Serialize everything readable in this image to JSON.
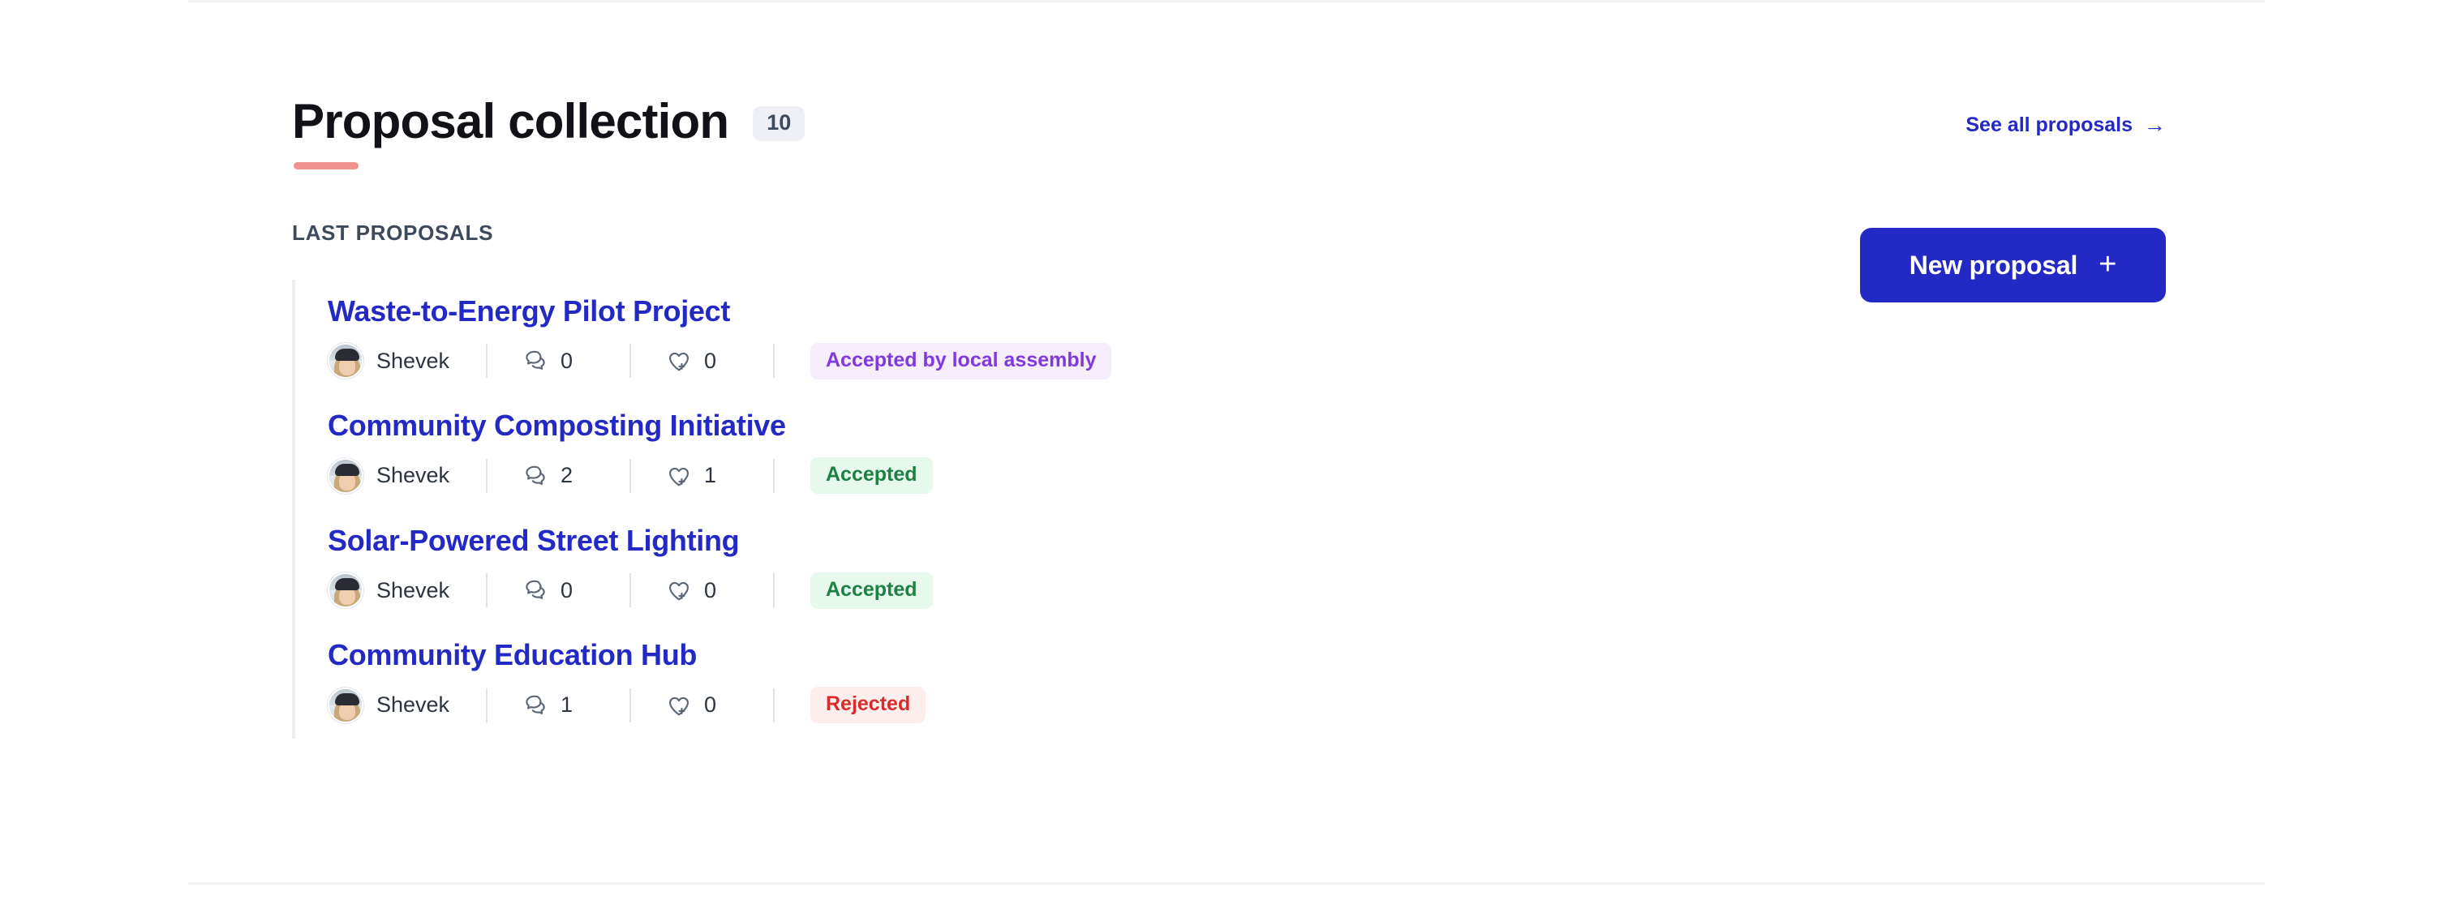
{
  "header": {
    "title": "Proposal collection",
    "count": "10",
    "see_all_label": "See all proposals",
    "see_all_arrow_icon": "arrow-right-icon",
    "underline_color": "#f0928e",
    "title_color": "#111118",
    "link_color": "#2329c4"
  },
  "subheader": {
    "section_label": "LAST PROPOSALS",
    "new_proposal_label": "New proposal",
    "new_proposal_plus_icon": "plus-icon",
    "button_color": "#2329c4"
  },
  "icons": {
    "comments": "comments-icon",
    "endorsements": "heart-plus-icon",
    "avatar": "user-avatar"
  },
  "proposals": [
    {
      "title": "Waste-to-Energy Pilot Project",
      "author": "Shevek",
      "comments": "0",
      "endorsements": "0",
      "status": "Accepted by local assembly",
      "status_style": "status-purple",
      "status_bg": "#f6edfd",
      "status_fg": "#8039dd"
    },
    {
      "title": "Community Composting Initiative",
      "author": "Shevek",
      "comments": "2",
      "endorsements": "1",
      "status": "Accepted",
      "status_style": "status-green",
      "status_bg": "#e7f8ec",
      "status_fg": "#1e8043"
    },
    {
      "title": "Solar-Powered Street Lighting",
      "author": "Shevek",
      "comments": "0",
      "endorsements": "0",
      "status": "Accepted",
      "status_style": "status-green",
      "status_bg": "#e7f8ec",
      "status_fg": "#1e8043"
    },
    {
      "title": "Community Education Hub",
      "author": "Shevek",
      "comments": "1",
      "endorsements": "0",
      "status": "Rejected",
      "status_style": "status-red",
      "status_bg": "#fdeeee",
      "status_fg": "#d92b2b"
    }
  ]
}
